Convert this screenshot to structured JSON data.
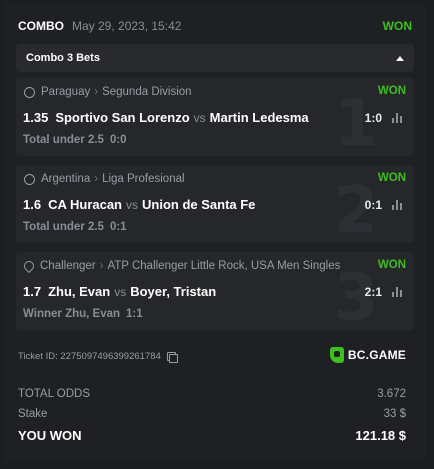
{
  "header": {
    "type": "COMBO",
    "date": "May 29, 2023, 15:42",
    "status": "WON"
  },
  "toggle": {
    "label": "Combo 3 Bets"
  },
  "bets": [
    {
      "index": "1",
      "icon": "soccer-ball-icon",
      "sport": "Paraguay",
      "league": "Segunda Division",
      "status": "WON",
      "odds": "1.35",
      "home": "Sportivo San Lorenzo",
      "vs": "vs",
      "away": "Martin Ledesma",
      "score": "1:0",
      "market": "Total under 2.5",
      "result": "0:0"
    },
    {
      "index": "2",
      "icon": "soccer-ball-icon",
      "sport": "Argentina",
      "league": "Liga Profesional",
      "status": "WON",
      "odds": "1.6",
      "home": "CA Huracan",
      "vs": "vs",
      "away": "Union de Santa Fe",
      "score": "0:1",
      "market": "Total under 2.5",
      "result": "0:1"
    },
    {
      "index": "3",
      "icon": "tennis-racket-icon",
      "sport": "Challenger",
      "league": "ATP Challenger Little Rock, USA Men Singles",
      "status": "WON",
      "odds": "1.7",
      "home": "Zhu, Evan",
      "vs": "vs",
      "away": "Boyer, Tristan",
      "score": "2:1",
      "market": "Winner Zhu, Evan",
      "result": "1:1"
    }
  ],
  "ticket": {
    "label": "Ticket ID: 2275097496399261784"
  },
  "brand": {
    "name": "BC.GAME"
  },
  "totals": {
    "odds_label": "TOTAL ODDS",
    "odds_value": "3.672",
    "stake_label": "Stake",
    "stake_value": "33 $",
    "won_label": "YOU WON",
    "won_value": "121.18 $"
  },
  "colors": {
    "accent_green": "#3bc117",
    "background": "#1f2023",
    "panel": "#25272b"
  }
}
